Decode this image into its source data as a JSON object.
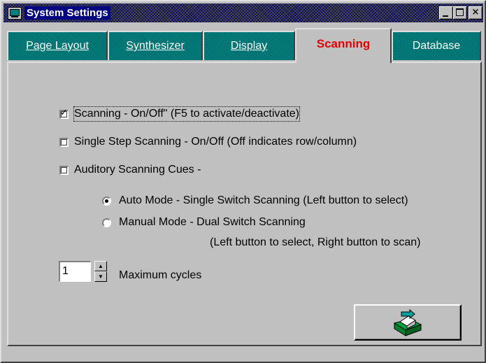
{
  "window": {
    "title": "System Settings",
    "minimize_label": "_",
    "close_label": "×"
  },
  "tabs": [
    {
      "label_first": "P",
      "label_rest": "age Layout",
      "active": false
    },
    {
      "label_first": "S",
      "label_rest": "ynthesizer",
      "active": false
    },
    {
      "label_first": "D",
      "label_rest": "isplay",
      "active": false
    },
    {
      "label": "Scanning",
      "active": true
    },
    {
      "label": "Database",
      "active": false
    }
  ],
  "options": {
    "scanning_onoff": {
      "label": "Scanning - On/Off\" (F5 to activate/deactivate)",
      "checked": true
    },
    "single_step": {
      "label": "Single Step Scanning - On/Off  (Off indicates row/column)",
      "checked": false
    },
    "auditory_cues": {
      "label": "Auditory Scanning Cues -",
      "checked": false
    }
  },
  "modes": {
    "auto": {
      "label": "Auto Mode - Single Switch Scanning (Left button to select)",
      "selected": true
    },
    "manual": {
      "label": "Manual Mode - Dual Switch Scanning",
      "detail": "(Left button to select, Right button to scan)",
      "selected": false
    }
  },
  "cycles": {
    "value": "1",
    "label": "Maximum cycles",
    "up_glyph": "▲",
    "down_glyph": "▼"
  },
  "ok_button": {
    "icon": "printer-disk-icon"
  },
  "colors": {
    "title_bar": "#000080",
    "tab_inactive": "#008080",
    "tab_active_text": "#e00000",
    "face": "#c0c0c0"
  }
}
